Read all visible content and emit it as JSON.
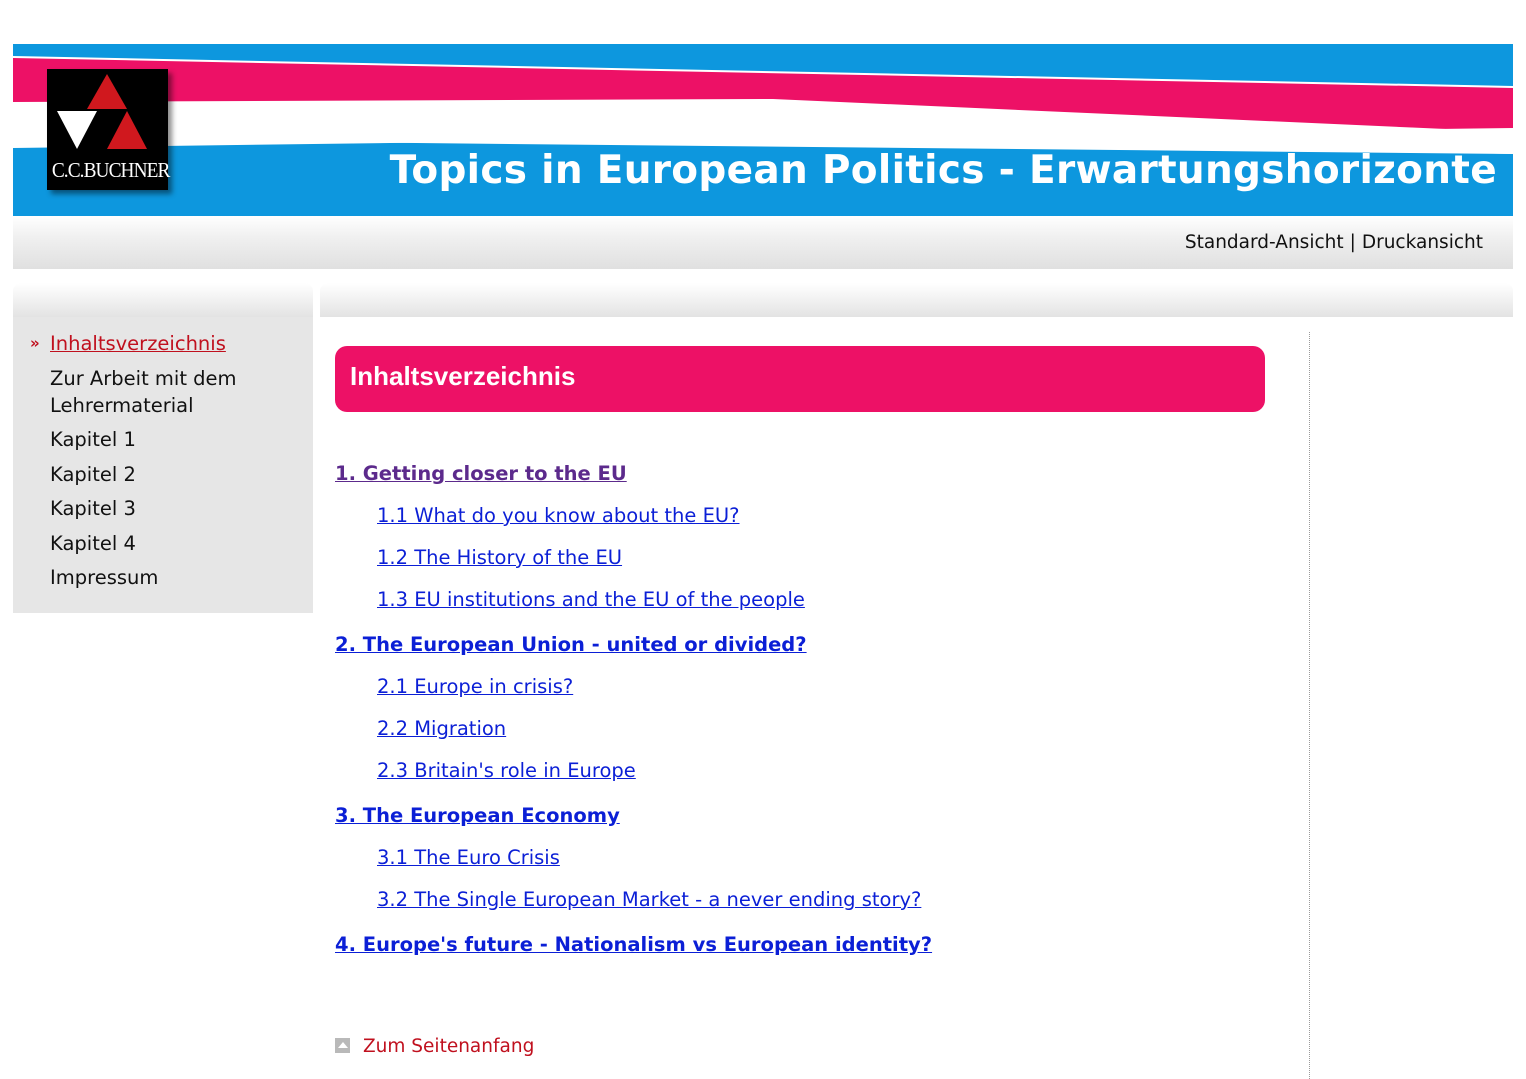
{
  "header": {
    "logo_text": "C.C.BUCHNER",
    "title": "Topics in European Politics - Erwartungshorizonte",
    "colors": {
      "blue": "#0d97de",
      "pink": "#ed1166",
      "white": "#ffffff"
    }
  },
  "view_switch": {
    "standard": "Standard-Ansicht",
    "separator": "|",
    "print": "Druckansicht"
  },
  "sidebar": {
    "active_marker": "»",
    "items": [
      {
        "label": "Inhaltsverzeichnis",
        "active": true
      },
      {
        "label": "Zur Arbeit mit dem Lehrermaterial"
      },
      {
        "label": "Kapitel 1"
      },
      {
        "label": "Kapitel 2"
      },
      {
        "label": "Kapitel 3"
      },
      {
        "label": "Kapitel 4"
      },
      {
        "label": "Impressum"
      }
    ]
  },
  "main": {
    "heading": "Inhaltsverzeichnis",
    "chapters": [
      {
        "title": "1. Getting closer to the EU",
        "visited": true,
        "sections": [
          "1.1 What do you know about the EU?",
          "1.2 The History of the EU",
          "1.3 EU institutions and the EU of the people"
        ]
      },
      {
        "title": "2. The European Union - united or divided?",
        "sections": [
          "2.1 Europe in crisis?",
          "2.2 Migration",
          "2.3 Britain's role in Europe"
        ]
      },
      {
        "title": "3. The European Economy",
        "sections": [
          "3.1 The Euro Crisis",
          "3.2 The Single European Market - a never ending story?"
        ]
      },
      {
        "title": "4. Europe's future - Nationalism vs European identity?",
        "sections": []
      }
    ],
    "to_top": "Zum Seitenanfang",
    "to_top_icon": "arrow-up-icon"
  }
}
